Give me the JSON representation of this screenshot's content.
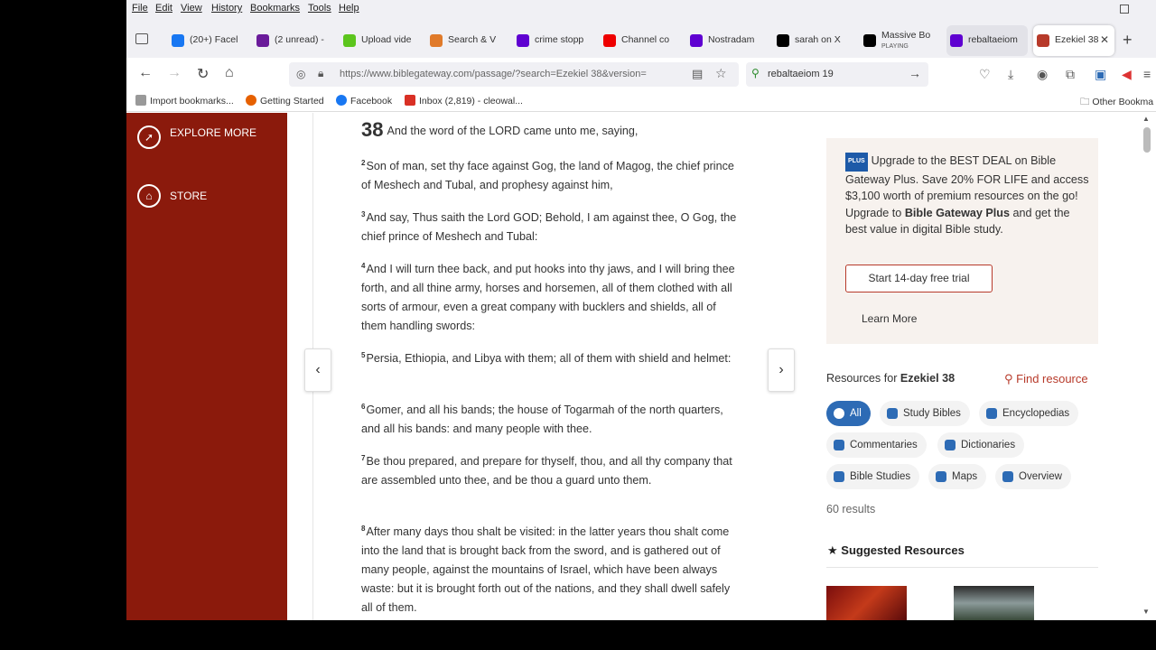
{
  "menu": [
    "File",
    "Edit",
    "View",
    "History",
    "Bookmarks",
    "Tools",
    "Help"
  ],
  "tabs": [
    {
      "label": "(20+) Facel",
      "icon": "facebook-icon",
      "color": "#1877f2"
    },
    {
      "label": "(2 unread) -",
      "icon": "mail-icon",
      "color": "#6a1b9a"
    },
    {
      "label": "Upload vide",
      "icon": "upload-icon",
      "color": "#5cc51d"
    },
    {
      "label": "Search & V",
      "icon": "search-icon",
      "color": "#e07a2a"
    },
    {
      "label": "crime stopp",
      "icon": "yahoo-icon",
      "color": "#5f01d1"
    },
    {
      "label": "Channel co",
      "icon": "youtube-icon",
      "color": "#e00"
    },
    {
      "label": "Nostradam",
      "icon": "yahoo-icon",
      "color": "#5f01d1"
    },
    {
      "label": "sarah on X",
      "icon": "x-icon",
      "color": "#000"
    },
    {
      "label": "Massive Bo",
      "sub": "PLAYING",
      "icon": "x-icon",
      "color": "#000"
    },
    {
      "label": "rebaltaeiom",
      "icon": "yahoo-icon",
      "color": "#5f01d1"
    },
    {
      "label": "Ezekiel 38",
      "icon": "biblegateway-icon",
      "color": "#b73a2a"
    }
  ],
  "url": "https://www.biblegateway.com/passage/?search=Ezekiel 38&version=",
  "search_query": "rebaltaeiom 19",
  "bookmarks": [
    {
      "label": "Import bookmarks...",
      "color": "#777"
    },
    {
      "label": "Getting Started",
      "color": "#e66000"
    },
    {
      "label": "Facebook",
      "color": "#1877f2"
    },
    {
      "label": "Inbox (2,819) - cleowal...",
      "color": "#d93025"
    }
  ],
  "other_bookmarks": "Other Bookma",
  "leftnav": {
    "explore": "EXPLORE MORE",
    "store": "STORE"
  },
  "passage": {
    "chapter": "38",
    "verses": [
      {
        "n": "",
        "text": "And the word of the LORD came unto me, saying,"
      },
      {
        "n": "2",
        "text": "Son of man, set thy face against Gog, the land of Magog, the chief prince of Meshech and Tubal, and prophesy against him,"
      },
      {
        "n": "3",
        "text": "And say, Thus saith the Lord GOD; Behold, I am against thee, O Gog, the chief prince of Meshech and Tubal:"
      },
      {
        "n": "4",
        "text": "And I will turn thee back, and put hooks into thy jaws, and I will bring thee forth, and all thine army, horses and horsemen, all of them clothed with all sorts of armour, even a great company with bucklers and shields, all of them handling swords:"
      },
      {
        "n": "5",
        "text": "Persia, Ethiopia, and Libya with them; all of them with shield and helmet:"
      },
      {
        "n": "6",
        "text": "Gomer, and all his bands; the house of Togarmah of the north quarters, and all his bands: and many people with thee."
      },
      {
        "n": "7",
        "text": "Be thou prepared, and prepare for thyself, thou, and all thy company that are assembled unto thee, and be thou a guard unto them."
      },
      {
        "n": "8",
        "text": "After many days thou shalt be visited: in the latter years thou shalt come into the land that is brought back from the sword, and is gathered out of many people, against the mountains of Israel, which have been always waste: but it is brought forth out of the nations, and they shall dwell safely all of them."
      }
    ]
  },
  "promo": {
    "badge": "PLUS",
    "text1": "Upgrade to the BEST DEAL on Bible Gateway Plus. Save 20% FOR LIFE and access $3,100 worth of premium resources on the go! Upgrade to ",
    "bold": "Bible Gateway Plus",
    "text2": " and get the best value in digital Bible study.",
    "trial": "Start 14-day free trial",
    "learn": "Learn More"
  },
  "resources": {
    "prefix": "Resources for ",
    "ref": "Ezekiel 38",
    "find": "Find resource",
    "chips": [
      "All",
      "Study Bibles",
      "Encyclopedias",
      "Commentaries",
      "Dictionaries",
      "Bible Studies",
      "Maps",
      "Overview"
    ],
    "results": "60 results",
    "suggested": "Suggested Resources"
  }
}
